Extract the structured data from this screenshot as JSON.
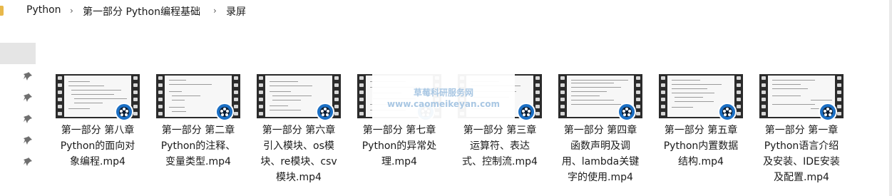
{
  "breadcrumb": {
    "items": [
      "Python",
      "第一部分 Python编程基础",
      "录屏"
    ]
  },
  "sidebar": {
    "pins": [
      "pin-icon",
      "pin-icon",
      "pin-icon",
      "pin-icon",
      "pin-icon"
    ]
  },
  "files": [
    {
      "name": "第一部分 第八章 Python的面向对象编程.mp4",
      "lines": [
        "第一部分 第八章",
        "Python的面向对",
        "象编程.mp4"
      ]
    },
    {
      "name": "第一部分 第二章 Python的注释、变量类型.mp4",
      "lines": [
        "第一部分 第二章",
        "Python的注释、",
        "变量类型.mp4"
      ]
    },
    {
      "name": "第一部分 第六章 引入模块、os模块、re模块、csv模块.mp4",
      "lines": [
        "第一部分 第六章",
        "引入模块、os模",
        "块、re模块、csv",
        "模块.mp4"
      ]
    },
    {
      "name": "第一部分 第七章 Python的异常处理.mp4",
      "lines": [
        "第一部分 第七章",
        "Python的异常处",
        "理.mp4"
      ]
    },
    {
      "name": "第一部分 第三章 运算符、表达式、控制流.mp4",
      "lines": [
        "第一部分 第三章",
        "运算符、表达",
        "式、控制流.mp4"
      ]
    },
    {
      "name": "第一部分 第四章 函数声明及调用、lambda关键字的使用.mp4",
      "lines": [
        "第一部分 第四章",
        "函数声明及调",
        "用、lambda关键",
        "字的使用.mp4"
      ]
    },
    {
      "name": "第一部分 第五章 Python内置数据结构.mp4",
      "lines": [
        "第一部分 第五章",
        "Python内置数据",
        "结构.mp4"
      ]
    },
    {
      "name": "第一部分 第一章 Python语言介绍及安装、IDE安装及配置.mp4",
      "lines": [
        "第一部分 第一章",
        "Python语言介绍",
        "及安装、IDE安装",
        "及配置.mp4"
      ]
    }
  ],
  "watermark": {
    "line1": "草莓科研服务网",
    "line2": "www.caomeikeyan.com"
  },
  "icons": {
    "video_badge": "video-reel-icon",
    "separator": "chevron-right-icon",
    "folder": "folder-icon"
  },
  "colors": {
    "badge": "#1b6fc4",
    "film": "#2b2b2b",
    "selection": "#e5e5e5"
  }
}
